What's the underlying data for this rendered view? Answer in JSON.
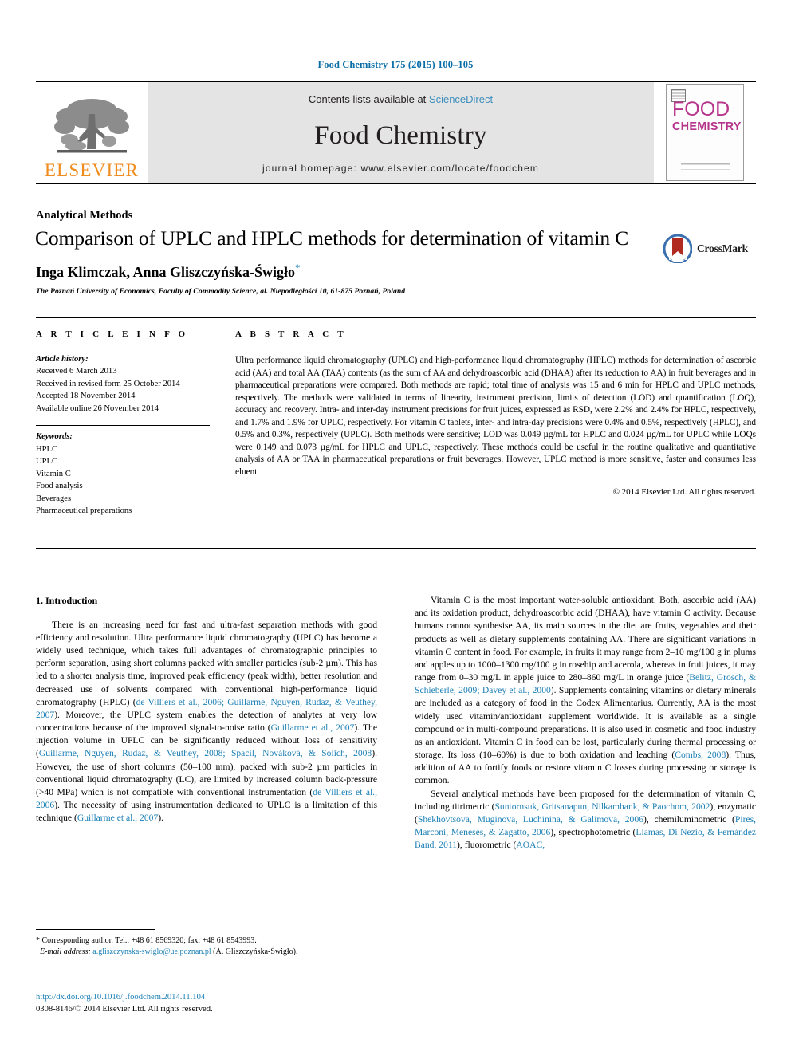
{
  "running_head": "Food Chemistry 175 (2015) 100–105",
  "masthead": {
    "contents_prefix": "Contents lists available at ",
    "sciencedirect": "ScienceDirect",
    "journal_name": "Food Chemistry",
    "homepage": "journal homepage: www.elsevier.com/locate/foodchem",
    "elsevier_wordmark": "ELSEVIER",
    "cover_title_top": "FOOD",
    "cover_title_bottom": "CHEMISTRY",
    "accent_blue": "#3d8fbe",
    "elsevier_orange": "#f08b1d",
    "cover_magenta": "#b6348c"
  },
  "article": {
    "section_label": "Analytical Methods",
    "title": "Comparison of UPLC and HPLC methods for determination of vitamin C",
    "authors": "Inga Klimczak, Anna Gliszczyńska-Świgło",
    "corresponding_marker": "*",
    "affiliation": "The Poznań University of Economics, Faculty of Commodity Science, al. Niepodległości 10, 61-875 Poznań, Poland",
    "crossmark_label": "CrossMark"
  },
  "info": {
    "heading": "A R T I C L E    I N F O",
    "history_title": "Article history:",
    "history": [
      "Received 6 March 2013",
      "Received in revised form 25 October 2014",
      "Accepted 18 November 2014",
      "Available online 26 November 2014"
    ],
    "keywords_title": "Keywords:",
    "keywords": [
      "HPLC",
      "UPLC",
      "Vitamin C",
      "Food analysis",
      "Beverages",
      "Pharmaceutical preparations"
    ]
  },
  "abstract": {
    "heading": "A B S T R A C T",
    "text": "Ultra performance liquid chromatography (UPLC) and high-performance liquid chromatography (HPLC) methods for determination of ascorbic acid (AA) and total AA (TAA) contents (as the sum of AA and dehydroascorbic acid (DHAA) after its reduction to AA) in fruit beverages and in pharmaceutical preparations were compared. Both methods are rapid; total time of analysis was 15 and 6 min for HPLC and UPLC methods, respectively. The methods were validated in terms of linearity, instrument precision, limits of detection (LOD) and quantification (LOQ), accuracy and recovery. Intra- and inter-day instrument precisions for fruit juices, expressed as RSD, were 2.2% and 2.4% for HPLC, respectively, and 1.7% and 1.9% for UPLC, respectively. For vitamin C tablets, inter- and intra-day precisions were 0.4% and 0.5%, respectively (HPLC), and 0.5% and 0.3%, respectively (UPLC). Both methods were sensitive; LOD was 0.049 µg/mL for HPLC and 0.024 µg/mL for UPLC while LOQs were 0.149 and 0.073 µg/mL for HPLC and UPLC, respectively. These methods could be useful in the routine qualitative and quantitative analysis of AA or TAA in pharmaceutical preparations or fruit beverages. However, UPLC method is more sensitive, faster and consumes less eluent.",
    "copyright": "© 2014 Elsevier Ltd. All rights reserved."
  },
  "introduction": {
    "heading": "1. Introduction",
    "left_paragraph_1_a": "There is an increasing need for fast and ultra-fast separation methods with good efficiency and resolution. Ultra performance liquid chromatography (UPLC) has become a widely used technique, which takes full advantages of chromatographic principles to perform separation, using short columns packed with smaller particles (sub-2 µm). This has led to a shorter analysis time, improved peak efficiency (peak width), better resolution and decreased use of solvents compared with conventional high-performance liquid chromatography (HPLC) (",
    "ref_1": "de Villiers et al., 2006; Guillarme, Nguyen, Rudaz, & Veuthey, 2007",
    "left_paragraph_1_b": "). Moreover, the UPLC system enables the detection of analytes at very low concentrations because of the improved signal-to-noise ratio (",
    "ref_2": "Guillarme et al., 2007",
    "left_paragraph_1_c": "). The injection volume in UPLC can be significantly reduced without loss of sensitivity (",
    "ref_3": "Guillarme, Nguyen, Rudaz, & Veuthey, 2008; Spacil, Nováková, & Solich, 2008",
    "left_paragraph_1_d": "). However, the use of short columns (50–100 mm), packed with sub-2 µm particles in conventional liquid chromatography (LC), are limited by increased column back-pressure (>40 MPa) which is not compatible with conventional instrumentation (",
    "ref_4": "de Villiers et al., 2006",
    "left_paragraph_1_e": "). The necessity of using instrumentation dedicated to UPLC is a limitation of this technique (",
    "ref_5": "Guillarme et al., 2007",
    "left_paragraph_1_f": ").",
    "right_paragraph_1_a": "Vitamin C is the most important water-soluble antioxidant. Both, ascorbic acid (AA) and its oxidation product, dehydroascorbic acid (DHAA), have vitamin C activity. Because humans cannot synthesise AA, its main sources in the diet are fruits, vegetables and their products as well as dietary supplements containing AA. There are significant variations in vitamin C content in food. For example, in fruits it may range from 2–10 mg/100 g in plums and apples up to 1000–1300 mg/100 g in rosehip and acerola, whereas in fruit juices, it may range from 0–30 mg/L in apple juice to 280–860 mg/L in orange juice (",
    "ref_6": "Belitz, Grosch, & Schieberle, 2009; Davey et al., 2000",
    "right_paragraph_1_b": "). Supplements containing vitamins or dietary minerals are included as a category of food in the Codex Alimentarius. Currently, AA is the most widely used vitamin/antioxidant supplement worldwide. It is available as a single compound or in multi-compound preparations. It is also used in cosmetic and food industry as an antioxidant. Vitamin C in food can be lost, particularly during thermal processing or storage. Its loss (10–60%) is due to both oxidation and leaching (",
    "ref_7": "Combs, 2008",
    "right_paragraph_1_c": "). Thus, addition of AA to fortify foods or restore vitamin C losses during processing or storage is common.",
    "right_paragraph_2_a": "Several analytical methods have been proposed for the determination of vitamin C, including titrimetric (",
    "ref_8": "Suntornsuk, Gritsanapun, Nilkamhank, & Paochom, 2002",
    "right_paragraph_2_b": "), enzymatic (",
    "ref_9": "Shekhovtsova, Muginova, Luchinina, & Galimova, 2006",
    "right_paragraph_2_c": "), chemiluminometric (",
    "ref_10": "Pires, Marconi, Meneses, & Zagatto, 2006",
    "right_paragraph_2_d": "), spectrophotometric (",
    "ref_11": "Llamas, Di Nezio, & Fernández Band, 2011",
    "right_paragraph_2_e": "), fluorometric (",
    "ref_12": "AOAC,",
    "link_color": "#1b7fb5"
  },
  "footnote": {
    "corresponding": "* Corresponding author. Tel.: +48 61 8569320; fax: +48 61 8543993.",
    "email_label": "E-mail address:",
    "email": "a.gliszczynska-swiglo@ue.poznan.pl",
    "email_owner": "(A. Gliszczyńska-Świgło)."
  },
  "bottom": {
    "doi": "http://dx.doi.org/10.1016/j.foodchem.2014.11.104",
    "issn_line": "0308-8146/© 2014 Elsevier Ltd. All rights reserved."
  }
}
